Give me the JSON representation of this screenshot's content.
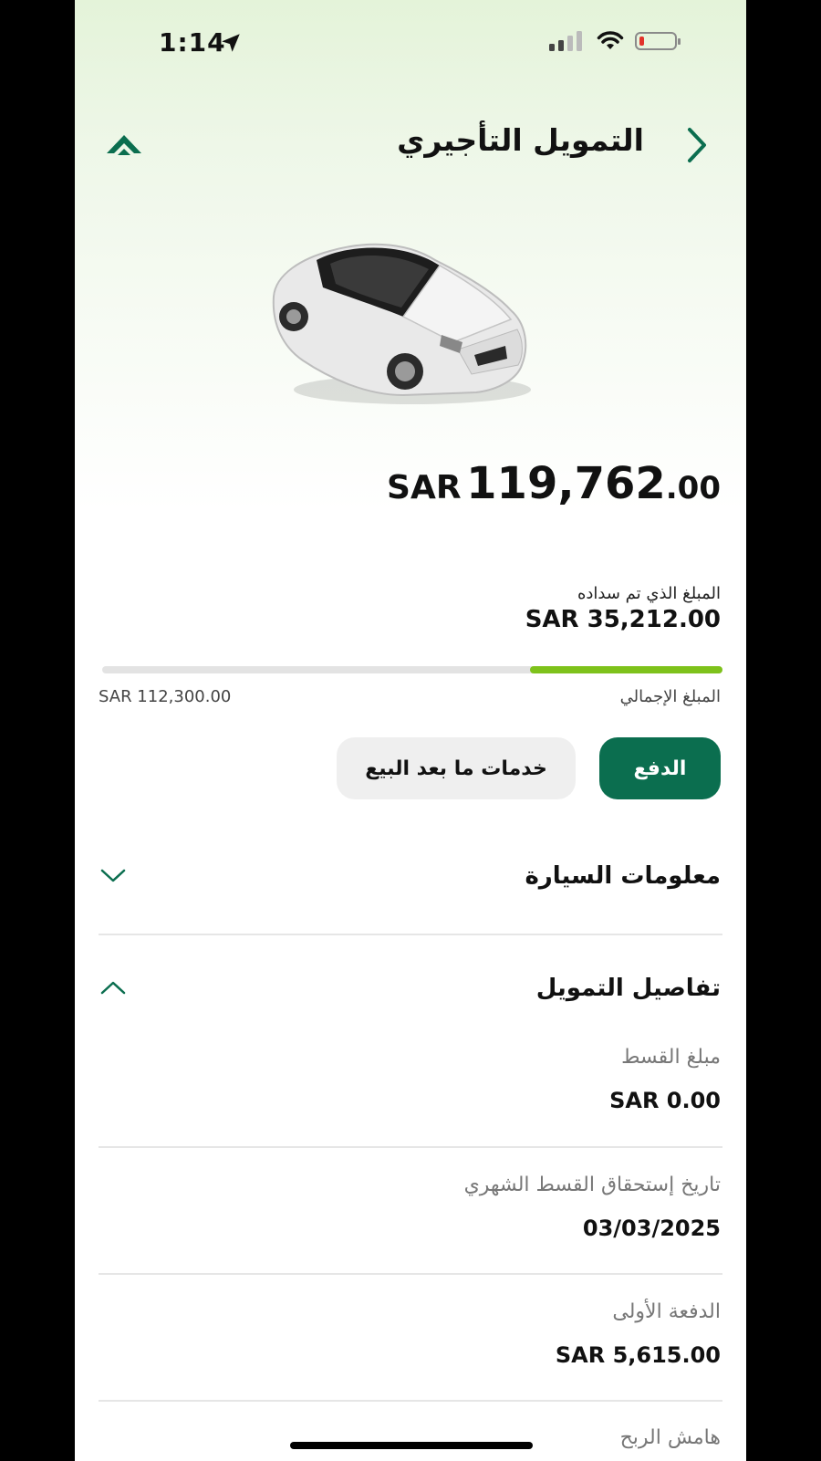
{
  "status_bar": {
    "time": "1:14",
    "icons": [
      "location-arrow-icon",
      "signal-icon",
      "wifi-icon",
      "battery-low-icon"
    ]
  },
  "header": {
    "title": "التمويل التأجيري",
    "back_icon": "chevron-right-icon",
    "brand_icon": "green-chevron-up-icon"
  },
  "car_image": "white-sedan",
  "price": {
    "currency": "SAR",
    "integer": "119,762",
    "decimals": ".00"
  },
  "paid": {
    "label": "المبلغ الذي تم سداده",
    "amount": "SAR 35,212.00"
  },
  "progress": {
    "fraction": 0.31,
    "colors": {
      "fill": "#7ec21b",
      "track": "#e3e3e3"
    }
  },
  "total": {
    "label": "المبلغ الإجمالي",
    "amount": "SAR 112,300.00"
  },
  "actions": {
    "pay": "الدفع",
    "after_sales": "خدمات ما بعد البيع"
  },
  "sections": {
    "car_info": {
      "title": "معلومات السيارة",
      "expanded": false
    },
    "financing": {
      "title": "تفاصيل التمويل",
      "expanded": true,
      "fields": [
        {
          "label": "مبلغ القسط",
          "value": "SAR 0.00"
        },
        {
          "label": "تاريخ إستحقاق القسط الشهري",
          "value": "03/03/2025"
        },
        {
          "label": "الدفعة الأولى",
          "value": "SAR 5,615.00"
        },
        {
          "label": "هامش الربح",
          "value": ""
        }
      ]
    }
  },
  "colors": {
    "accent": "#0b6e4f",
    "progress": "#7ec21b"
  }
}
